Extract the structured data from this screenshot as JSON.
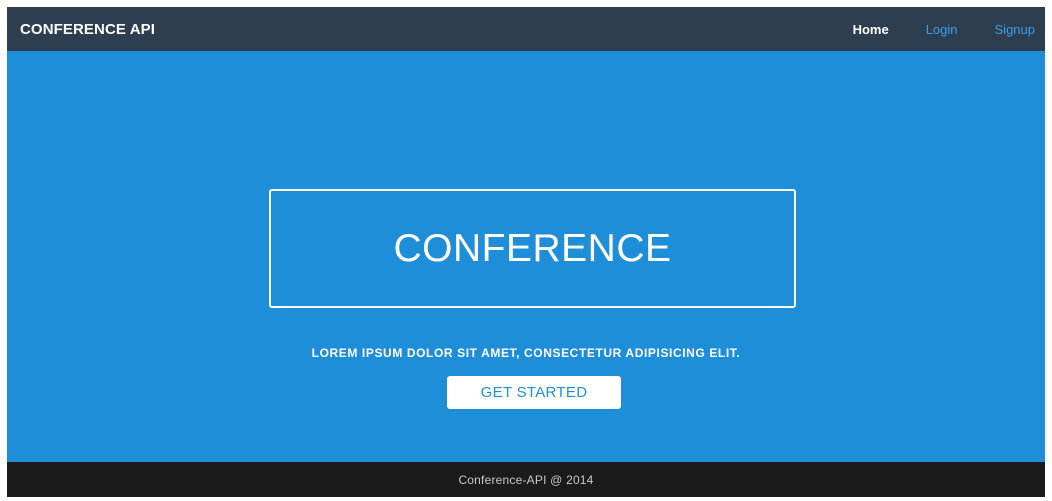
{
  "navbar": {
    "brand": "CONFERENCE API",
    "links": [
      {
        "label": "Home",
        "active": true
      },
      {
        "label": "Login",
        "active": false
      },
      {
        "label": "Signup",
        "active": false
      }
    ]
  },
  "hero": {
    "title": "CONFERENCE",
    "tagline": "LOREM IPSUM DOLOR SIT AMET, CONSECTETUR ADIPISICING ELIT.",
    "cta_label": "GET STARTED"
  },
  "footer": {
    "text": "Conference-API @ 2014"
  },
  "colors": {
    "navbar_bg": "#2c3e50",
    "hero_bg": "#1f8ed8",
    "footer_bg": "#1b1b1b",
    "link_color": "#3aa0e6",
    "accent": "#1f8ed8"
  }
}
